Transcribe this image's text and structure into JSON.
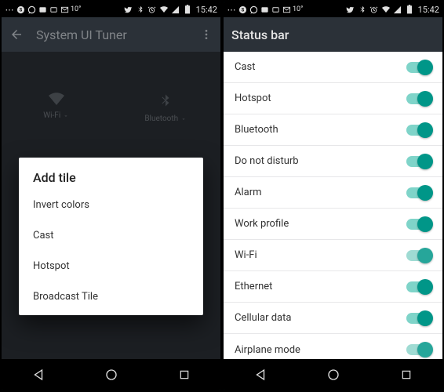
{
  "status": {
    "time": "15:42",
    "icons_left": [
      "dots",
      "skype",
      "whatsapp",
      "inbox",
      "battery-card",
      "gmail",
      "temp"
    ],
    "temp_text": "10°",
    "icons_right": [
      "twitter",
      "bluetooth",
      "alarm",
      "wifi",
      "signal",
      "battery"
    ]
  },
  "left": {
    "appbar_title": "System UI Tuner",
    "qs": {
      "wifi_label": "Wi-Fi",
      "bt_label": "Bluetooth"
    },
    "faint_add": "Add tile",
    "dialog": {
      "title": "Add tile",
      "items": [
        "Invert colors",
        "Cast",
        "Hotspot",
        "Broadcast Tile"
      ]
    }
  },
  "right": {
    "appbar_title": "Status bar",
    "rows": [
      "Cast",
      "Hotspot",
      "Bluetooth",
      "Do not disturb",
      "Alarm",
      "Work profile",
      "Wi-Fi",
      "Ethernet",
      "Cellular data",
      "Airplane mode"
    ]
  },
  "colors": {
    "accent": "#009688",
    "appbar": "#2b3138",
    "bg_dark": "#1c1f23"
  }
}
